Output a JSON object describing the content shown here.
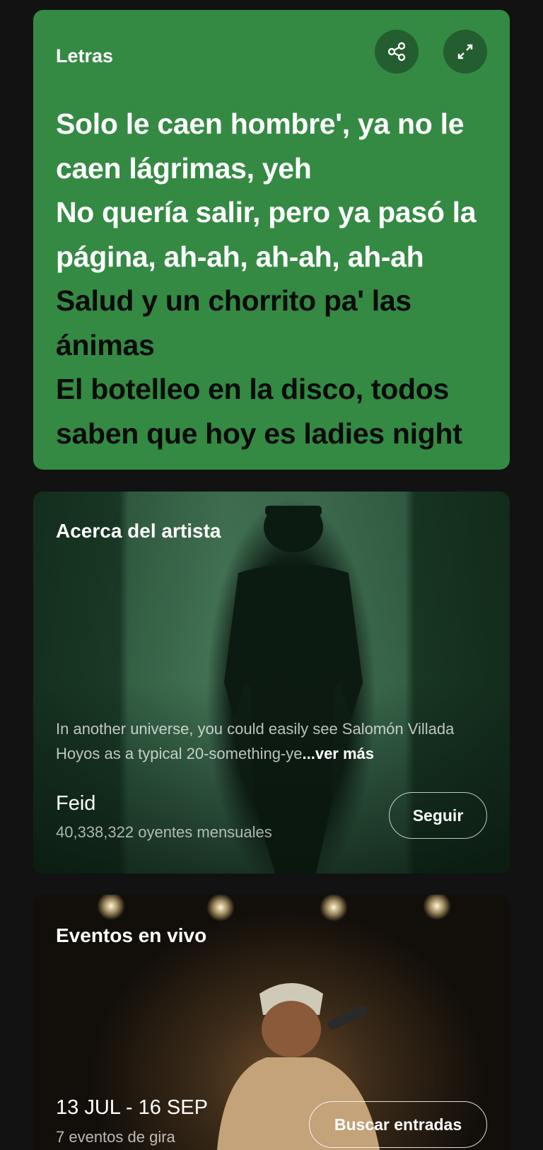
{
  "lyrics": {
    "title": "Letras",
    "share_icon": "share-icon",
    "expand_icon": "expand-icon",
    "lines_sung": [
      "Solo le caen hombre', ya no le",
      "caen lágrimas, yeh",
      "No quería salir, pero ya pasó la",
      "página, ah-ah, ah-ah, ah-ah"
    ],
    "lines_upcoming": [
      "Salud y un chorrito pa' las",
      "ánimas",
      "El botelleo en la disco, todos",
      "saben que hoy es ladies night"
    ],
    "colors": {
      "card": "#348a43",
      "sung": "#ffffff",
      "upcoming": "#0b0b0b"
    }
  },
  "artist": {
    "title": "Acerca del artista",
    "bio": "In another universe, you could easily see Salomón Villada Hoyos as a typical 20-something-ye",
    "bio_more": "...ver más",
    "name": "Feid",
    "listeners": "40,338,322 oyentes mensuales",
    "follow_label": "Seguir"
  },
  "events": {
    "title": "Eventos en vivo",
    "dates": "13 JUL - 16 SEP",
    "count": "7 eventos de gira",
    "tickets_label": "Buscar entradas"
  }
}
